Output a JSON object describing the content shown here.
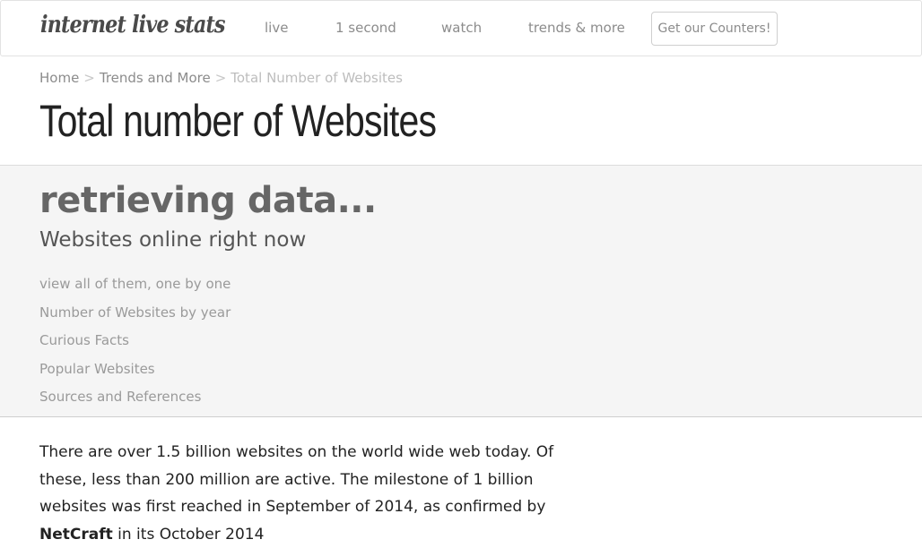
{
  "navbar": {
    "logo": "internet live stats",
    "links": [
      "live",
      "1 second",
      "watch",
      "trends & more"
    ],
    "cta": "Get our Counters!"
  },
  "breadcrumb": {
    "home": "Home",
    "section": "Trends and More",
    "separator": ">",
    "current": "Total Number of Websites"
  },
  "page": {
    "title": "Total number of Websites"
  },
  "stats": {
    "counter": "retrieving data...",
    "label": "Websites online right now",
    "links": [
      "view all of them, one by one",
      "Number of Websites by year",
      "Curious Facts",
      "Popular Websites",
      "Sources and References"
    ]
  },
  "intro": {
    "part1": "There are over 1.5 billion websites on the world wide web today. Of these, less than 200 million are active. The milestone of 1 billion websites was first reached in September of 2014, as confirmed by ",
    "source": "NetCraft",
    "part2": " in its October 2014"
  }
}
